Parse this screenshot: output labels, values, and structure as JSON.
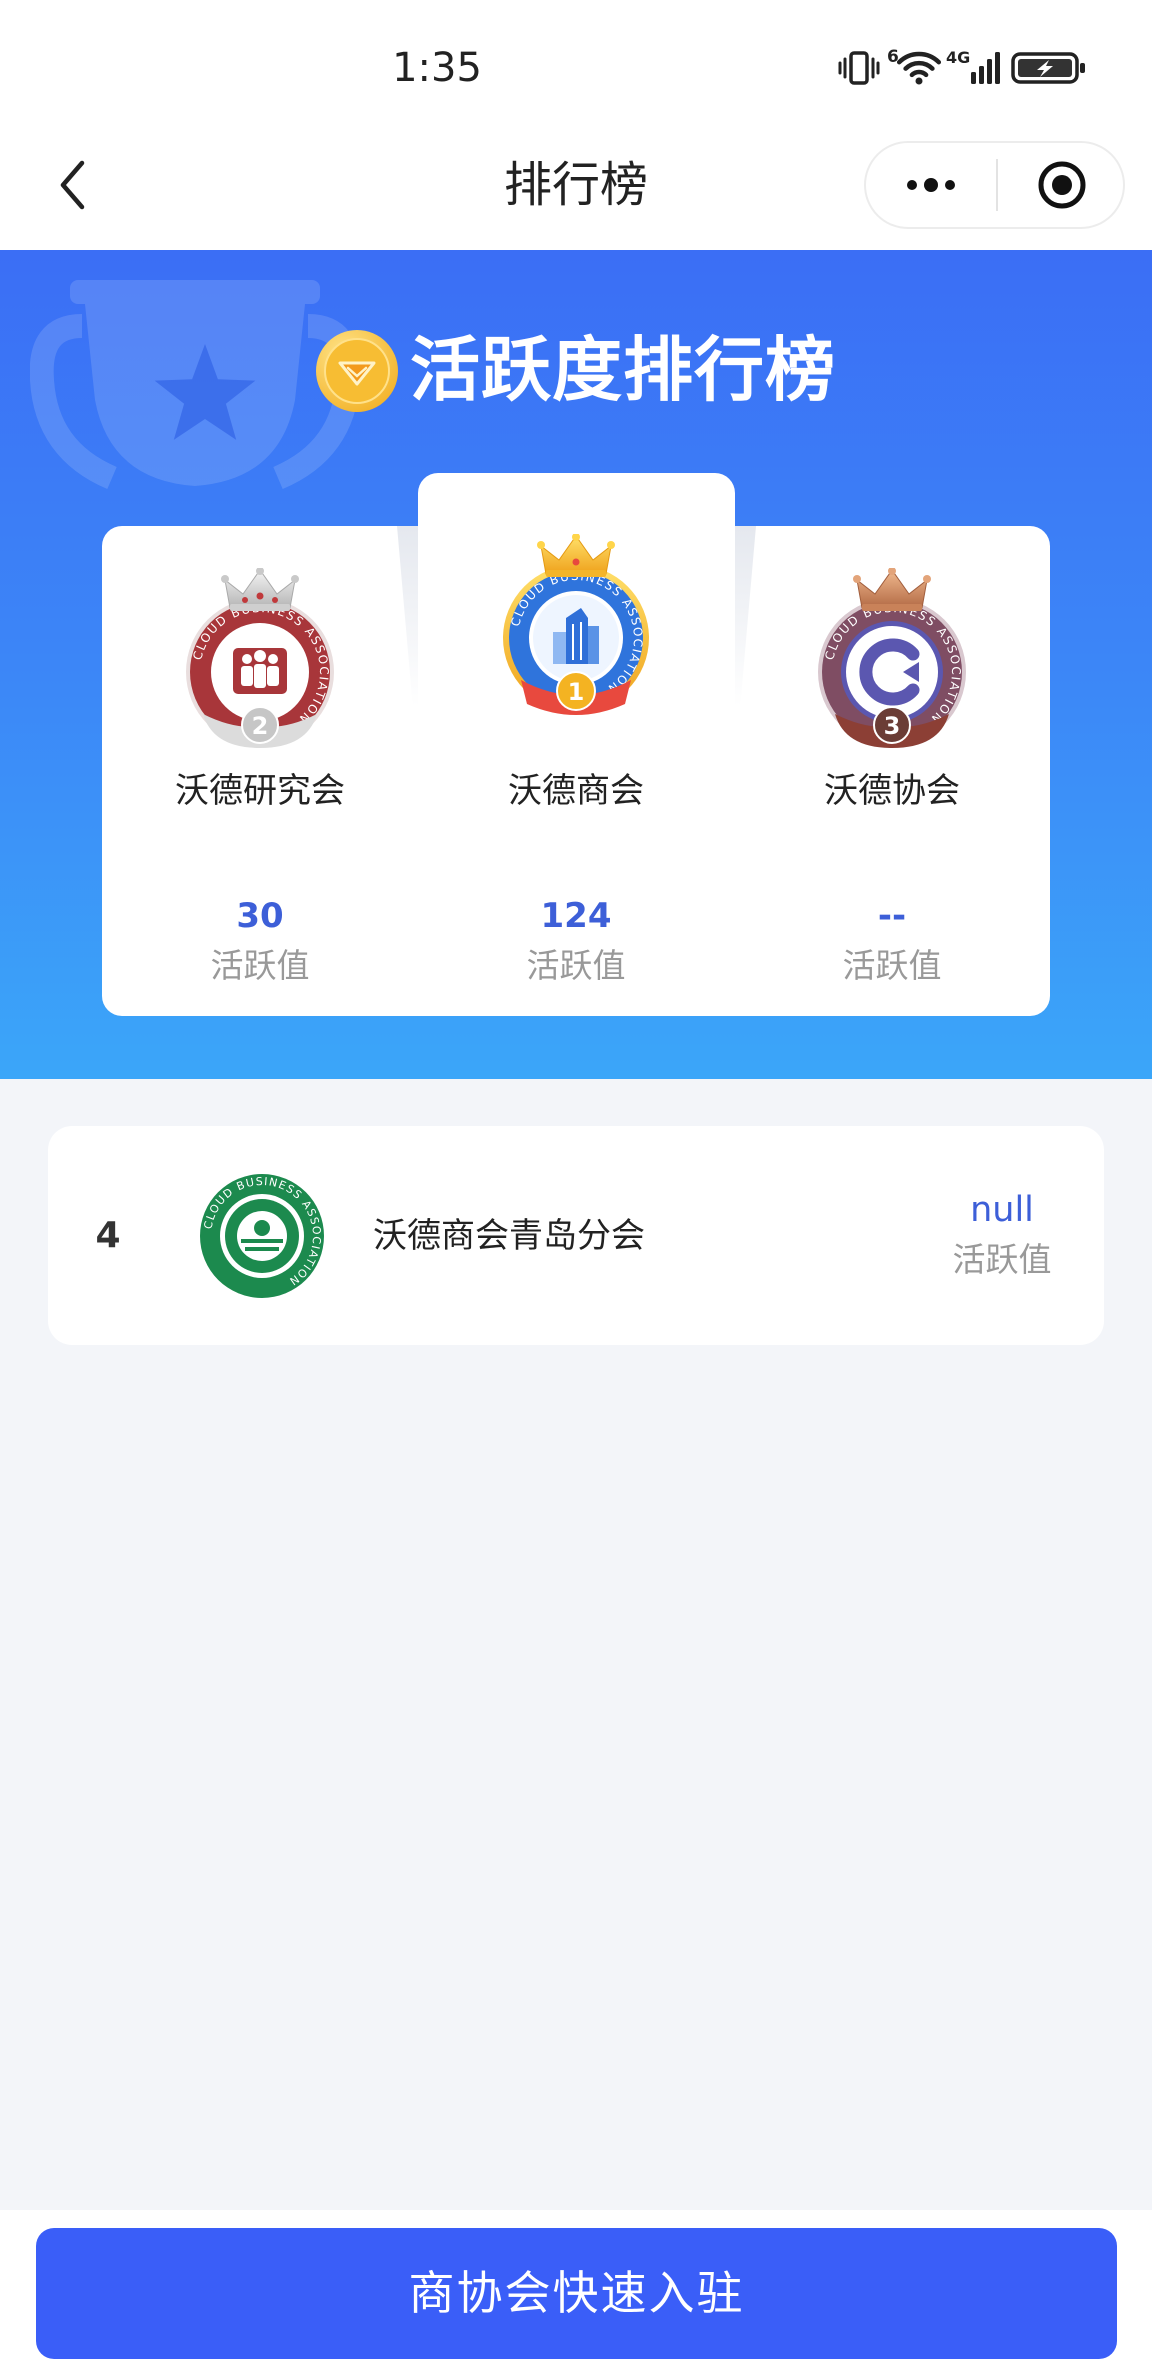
{
  "status_bar": {
    "time": "1:35",
    "wifi_label": "6",
    "signal_label": "4G"
  },
  "nav": {
    "title": "排行榜"
  },
  "header": {
    "title": "活跃度排行榜"
  },
  "podium": [
    {
      "rank": "2",
      "name": "沃德研究会",
      "value": "30",
      "value_label": "活跃值"
    },
    {
      "rank": "1",
      "name": "沃德商会",
      "value": "124",
      "value_label": "活跃值"
    },
    {
      "rank": "3",
      "name": "沃德协会",
      "value": "--",
      "value_label": "活跃值"
    }
  ],
  "list": [
    {
      "rank": "4",
      "name": "沃德商会青岛分会",
      "value": "null",
      "value_label": "活跃值"
    }
  ],
  "badge_text": "CLOUD BUSINESS ASSOCIATION",
  "footer": {
    "join_button": "商协会快速入驻"
  },
  "colors": {
    "accent": "#3a5ef8",
    "value_blue": "#3d5fd8",
    "header_top": "#3b6ef5",
    "header_bottom": "#3ba6f9",
    "page_background": "#f3f5f9"
  },
  "icons": {
    "status": [
      "vibrate-icon",
      "wifi-icon",
      "signal-icon",
      "battery-charging-icon"
    ],
    "nav_back": "chevron-left-icon",
    "nav_more": "more-dots-icon",
    "nav_close": "target-circle-icon",
    "header_medal": "gold-medal-icon",
    "header_watermark": "trophy-icon"
  }
}
